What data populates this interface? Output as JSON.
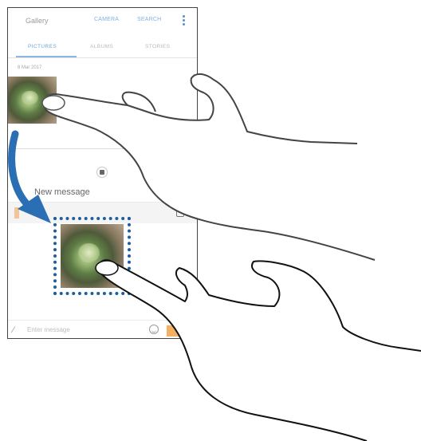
{
  "gallery": {
    "title": "Gallery",
    "actions": [
      "CAMERA",
      "SEARCH"
    ],
    "more_icon": "more-vertical-icon",
    "tabs": [
      {
        "label": "PICTURES",
        "active": true
      },
      {
        "label": "ALBUMS",
        "active": false
      },
      {
        "label": "STORIES",
        "active": false
      }
    ],
    "date": "8 Mar 2017"
  },
  "messages": {
    "title": "New message",
    "input_placeholder": "Enter message",
    "icons": [
      "paperclip-icon",
      "emoji-icon",
      "contact-icon",
      "split-handle-icon"
    ]
  },
  "colors": {
    "accent_blue": "#6ea6d8",
    "drag_arrow": "#2a6fb3",
    "drop_border": "#1f5e9e",
    "send_button": "#f4b163"
  }
}
